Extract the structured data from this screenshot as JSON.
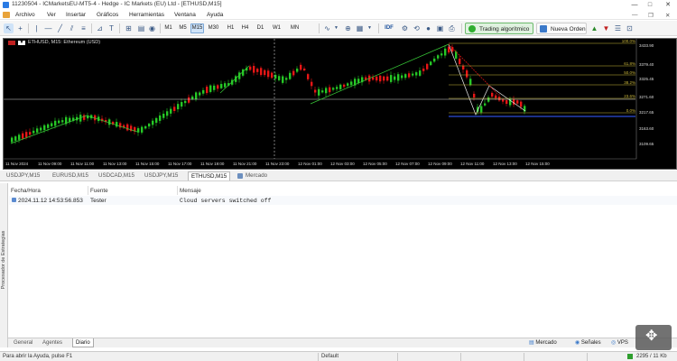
{
  "window": {
    "title": "11230504 - ICMarketsEU-MT5-4 - Hedge - IC Markets (EU) Ltd - [ETHUSD,M15]",
    "controls": [
      "—",
      "□",
      "✕"
    ]
  },
  "menu": [
    "Archivo",
    "Ver",
    "Insertar",
    "Gráficos",
    "Herramientas",
    "Ventana",
    "Ayuda"
  ],
  "toolbar": {
    "timeframes": [
      "M1",
      "M5",
      "M15",
      "M30",
      "H1",
      "H4",
      "D1",
      "W1",
      "MN"
    ],
    "active_timeframe": "M15",
    "algo_trading_label": "Trading algorítmico",
    "new_order_label": "Nueva Orden",
    "idf_label": "IDF"
  },
  "chart": {
    "symbol_label": "ETHUSD, M15: Ethereum (USD)",
    "price_labels": [
      "3433.90",
      "3379.40",
      "3325.45",
      "3271.60",
      "3217.65",
      "3163.60",
      "3109.65"
    ],
    "fib_levels": [
      "100.0%",
      "61.8%",
      "50.0%",
      "38.2%",
      "23.6%",
      "0.0%"
    ],
    "time_labels": [
      "11 Nov 2024",
      "11 Nov 09:00",
      "11 Nov 11:00",
      "11 Nov 13:00",
      "11 Nov 15:00",
      "11 Nov 17:00",
      "11 Nov 19:00",
      "11 Nov 21:00",
      "11 Nov 23:00",
      "12 Nov 01:00",
      "12 Nov 03:00",
      "12 Nov 05:00",
      "12 Nov 07:00",
      "12 Nov 09:00",
      "12 Nov 11:00",
      "12 Nov 13:00",
      "12 Nov 15:00"
    ],
    "colors": {
      "bull": "#26c826",
      "bear": "#e81616",
      "fib": "#c9b63a",
      "trend": "#37c837",
      "background": "#000000"
    }
  },
  "chart_tabs": [
    "USDJPY,M15",
    "EURUSD,M15",
    "USDCAD,M15",
    "USDJPY,M15",
    "ETHUSD,M15",
    "Mercado"
  ],
  "active_chart_tab": "ETHUSD,M15",
  "toolbox": {
    "columns": [
      "Fecha/Hora",
      "Fuente",
      "Mensaje"
    ],
    "rows": [
      {
        "time": "2024.11.12 14:53:56.853",
        "source": "Tester",
        "message": "Cloud servers switched off"
      }
    ],
    "vertical_label": "Procesador de Estrategias",
    "tabs": [
      "General",
      "Agentes",
      "Diario"
    ],
    "active_tab": "Diario",
    "buttons": [
      "Mercado",
      "Señales",
      "VPS"
    ]
  },
  "status": {
    "help": "Para abrir la Ayuda, pulse F1",
    "profile": "Default",
    "traffic": "2295 / 11 Kb"
  }
}
